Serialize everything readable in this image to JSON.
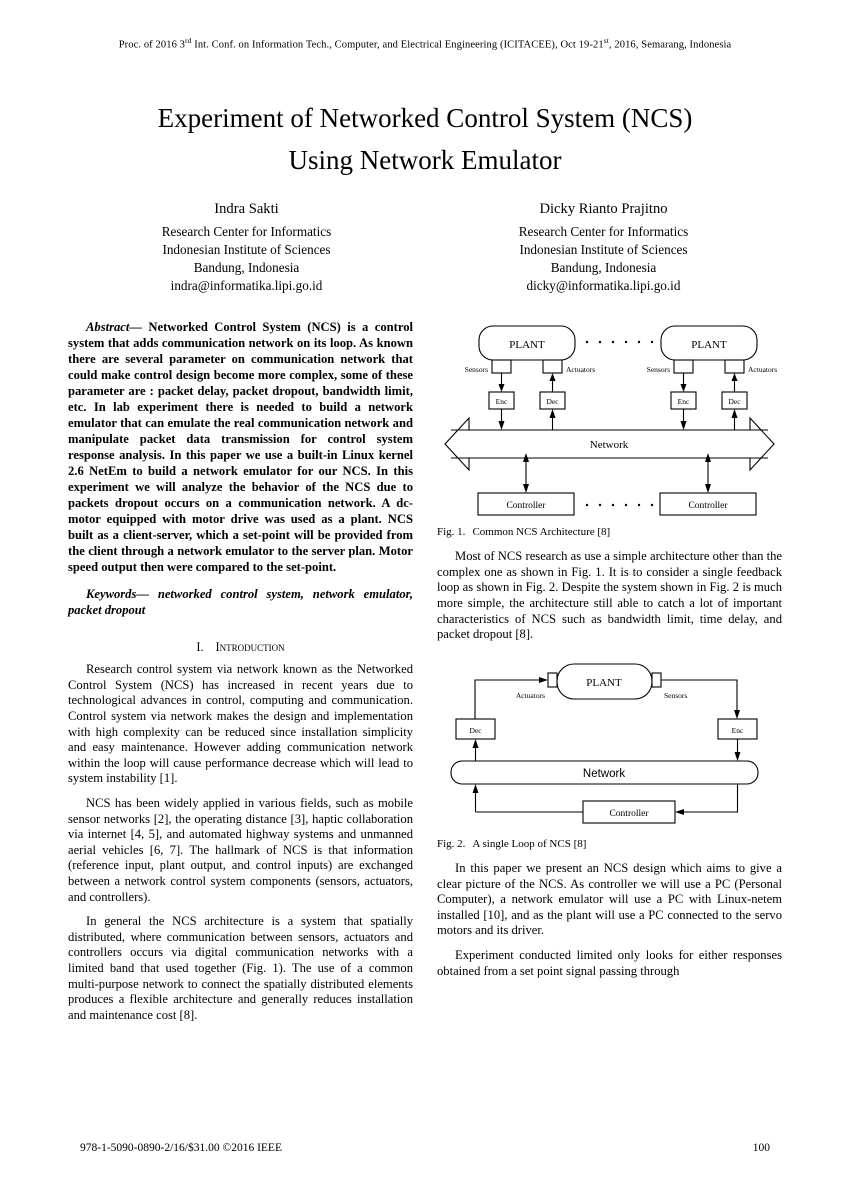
{
  "header": {
    "running_head_pre": "Proc. of 2016 3",
    "running_head_sup1": "rd",
    "running_head_mid": " Int. Conf. on Information Tech., Computer, and Electrical Engineering (ICITACEE), Oct 19-21",
    "running_head_sup2": "st",
    "running_head_post": ", 2016, Semarang, Indonesia"
  },
  "title": {
    "line1": "Experiment of Networked Control System (NCS)",
    "line2": "Using Network Emulator"
  },
  "authors": [
    {
      "name": "Indra Sakti",
      "affiliation1": "Research Center for Informatics",
      "affiliation2": "Indonesian Institute of Sciences",
      "location": "Bandung, Indonesia",
      "email": "indra@informatika.lipi.go.id"
    },
    {
      "name": "Dicky Rianto Prajitno",
      "affiliation1": "Research Center for Informatics",
      "affiliation2": "Indonesian Institute of Sciences",
      "location": "Bandung, Indonesia",
      "email": "dicky@informatika.lipi.go.id"
    }
  ],
  "abstract": {
    "lead": "Abstract—",
    "text": " Networked Control System (NCS) is a control system that adds communication network on its loop. As known there are several parameter on communication network that could make control design become more complex, some of these parameter are : packet delay, packet dropout, bandwidth limit, etc. In lab experiment there is needed to build a network emulator that can emulate the real communication network and manipulate packet data transmission for control system response analysis. In this paper we use a built-in Linux kernel 2.6 NetEm to build a network emulator for our NCS. In this experiment we will analyze the behavior of the NCS due to packets dropout occurs on a communication network. A dc-motor equipped with motor drive was used as a plant. NCS built as a client-server, which a set-point will be provided from the client through a network emulator to the   server plan. Motor speed output then were compared to the set-point."
  },
  "keywords": {
    "lead": "Keywords—",
    "text": " networked control system, network emulator, packet dropout"
  },
  "sections": {
    "intro": {
      "numeral": "I.",
      "title": "Introduction",
      "paragraphs": [
        "Research control system via network known as the Networked Control System (NCS) has increased in recent years due to technological advances in control, computing and communication. Control system via network makes the design and implementation with high complexity can be reduced since installation simplicity and easy maintenance. However adding communication network within the loop will cause performance decrease which will lead to system instability [1].",
        "NCS has been widely applied in various fields, such as mobile sensor networks [2], the operating distance [3], haptic collaboration via internet [4, 5], and automated highway systems and unmanned aerial vehicles [6, 7]. The hallmark of NCS is that information (reference input, plant output, and control inputs) are exchanged between a network control system components (sensors, actuators, and controllers).",
        "In general the NCS architecture is a system that spatially distributed, where communication between sensors, actuators and controllers occurs via digital communication networks with a limited band that used together (Fig. 1). The use of a common multi-purpose network to connect the spatially distributed elements produces a flexible architecture and generally reduces installation and maintenance cost [8]."
      ]
    },
    "right_column_paragraphs": [
      "Most of NCS research as use a simple architecture other than the complex one as shown in Fig. 1. It is to consider a single feedback loop as shown in Fig. 2. Despite the system shown in Fig.  2 is much more simple, the architecture still able to catch a lot of important characteristics of NCS such as bandwidth limit, time delay, and packet dropout [8].",
      "In this paper we present an NCS design which aims to give a clear picture of the NCS. As controller we will use a PC (Personal Computer), a network emulator will use a PC with Linux-netem installed [10], and as the plant will use a PC connected to the servo motors and its driver.",
      "Experiment conducted limited only looks for either responses obtained from a set point signal passing through"
    ]
  },
  "figures": [
    {
      "id": "fig1",
      "caption_label": "Fig. 1.",
      "caption_text": "Common NCS Architecture [8]",
      "labels": {
        "plant_left": "PLANT",
        "plant_right": "PLANT",
        "sensors_left": "Sensors",
        "actuators_left": "Actuators",
        "sensors_right": "Sensors",
        "actuators_right": "Actuators",
        "enc_left": "Enc",
        "dec_left": "Dec",
        "enc_right": "Enc",
        "dec_right": "Dec",
        "network": "Network",
        "controller_left": "Controller",
        "controller_right": "Controller"
      }
    },
    {
      "id": "fig2",
      "caption_label": "Fig. 2.",
      "caption_text": "A single Loop of NCS [8]",
      "labels": {
        "plant": "PLANT",
        "actuators": "Actuators",
        "sensors": "Sensors",
        "dec": "Dec",
        "enc": "Enc",
        "network": "Network",
        "controller": "Controller"
      }
    }
  ],
  "footer": {
    "isbn": "978-1-5090-0890-2/16/$31.00 ©2016 IEEE",
    "page_number": "100"
  }
}
